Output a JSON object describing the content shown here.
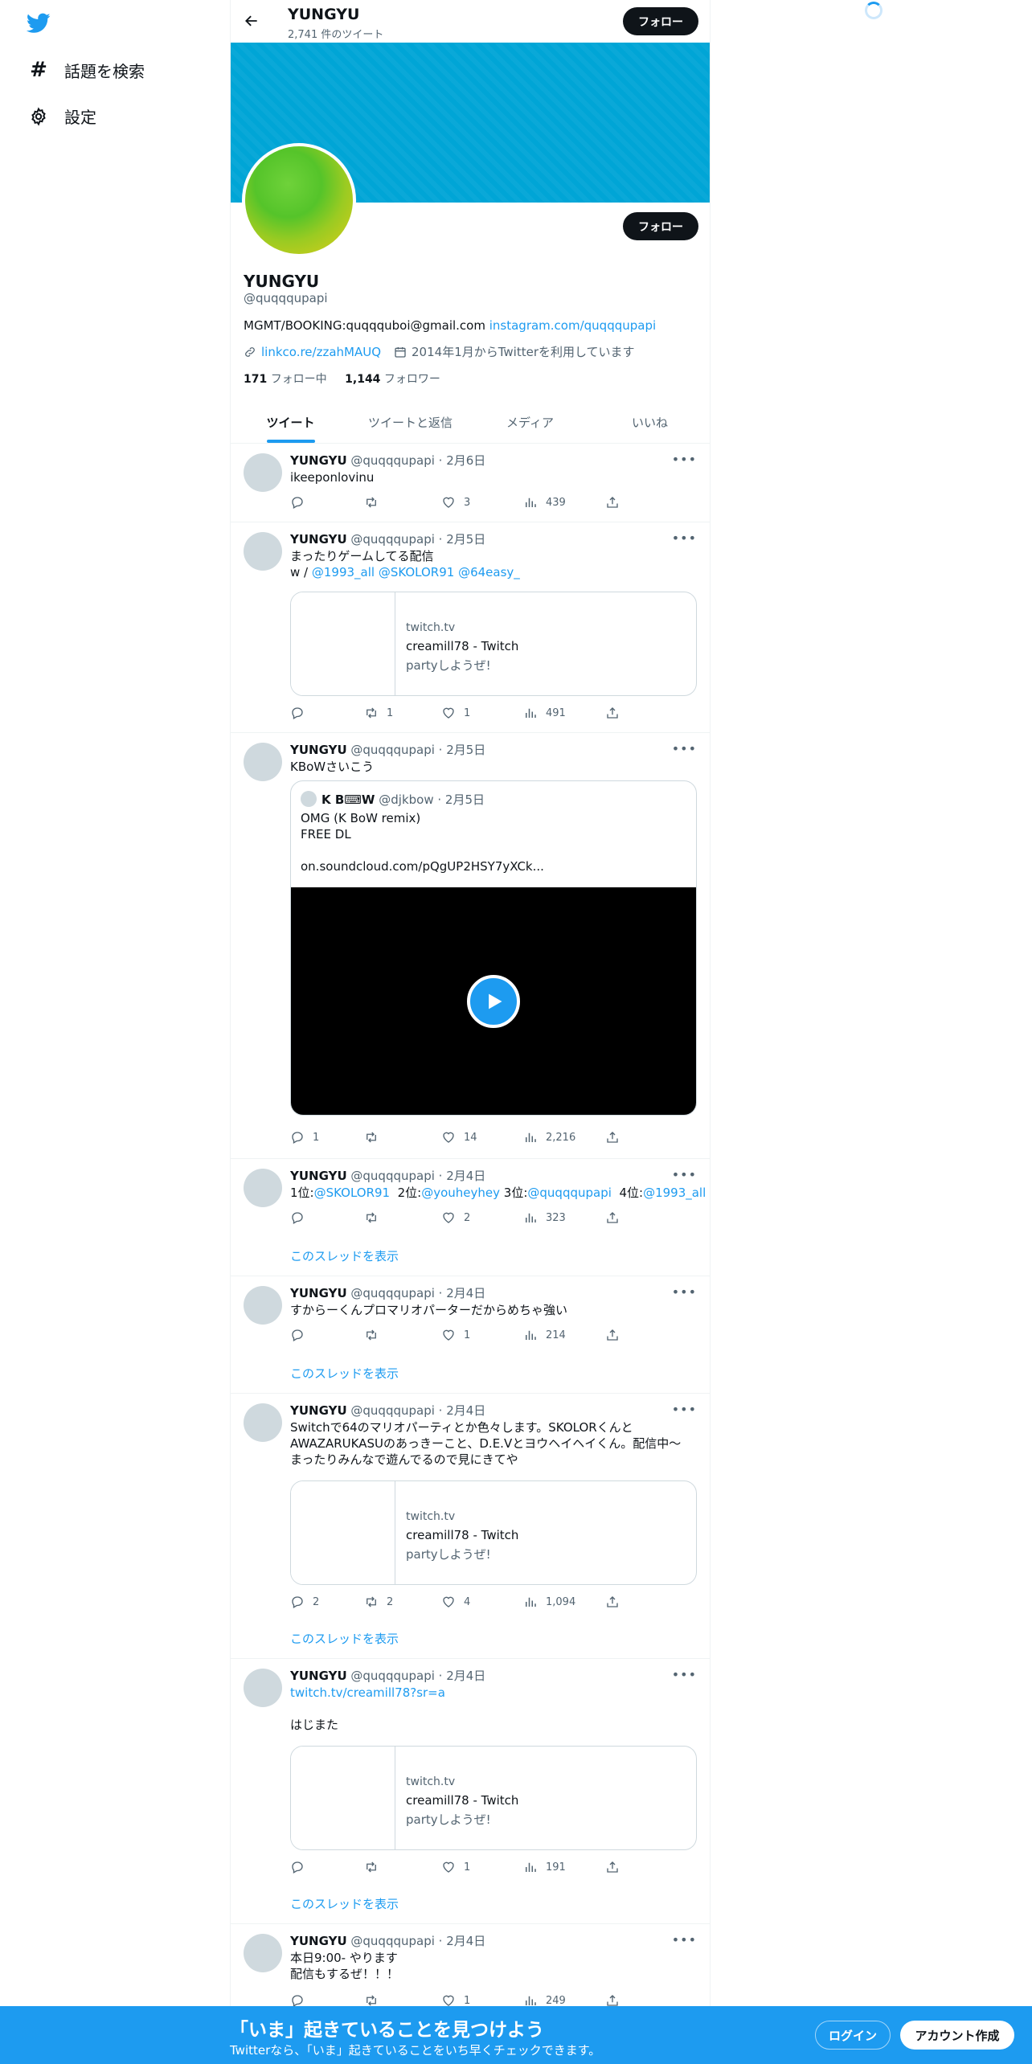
{
  "nav": {
    "explore": "話題を検索",
    "settings": "設定"
  },
  "header": {
    "name": "YUNGYU",
    "tweet_count": "2,741 件のツイート",
    "follow": "フォロー"
  },
  "profile": {
    "follow": "フォロー",
    "name": "YUNGYU",
    "handle": "@quqqqupapi",
    "bio_text": "MGMT/BOOKING:quqqquboi@gmail.com",
    "bio_link": "instagram.com/quqqqupapi",
    "website": "linkco.re/zzahMAUQ",
    "joined": "2014年1月からTwitterを利用しています",
    "following_count": "171",
    "following_label": "フォロー中",
    "followers_count": "1,144",
    "followers_label": "フォロワー"
  },
  "tabs": [
    "ツイート",
    "ツイートと返信",
    "メディア",
    "いいね"
  ],
  "tweets": [
    {
      "name": "YUNGYU",
      "meta": "@quqqqupapi · 2月6日",
      "text": "ikeeponlovinu",
      "reply": "",
      "retweet": "",
      "like": "3",
      "views": "439"
    },
    {
      "name": "YUNGYU",
      "meta": "@quqqqupapi · 2月5日",
      "text1": "まったりゲームしてる配信",
      "text2a": "w / ",
      "mentions": "@1993_all  @SKOLOR91 @64easy_",
      "card_site": "twitch.tv",
      "card_title": "creamill78 - Twitch",
      "card_desc": "partyしようぜ!",
      "reply": "",
      "retweet": "1",
      "like": "1",
      "views": "491"
    },
    {
      "name": "YUNGYU",
      "meta": "@quqqqupapi · 2月5日",
      "text": "KBoWさいこう",
      "quote_name": "K B⌨W",
      "quote_meta": "@djkbow · 2月5日",
      "quote_text": "OMG (K BoW remix)\nFREE DL\n\non.soundcloud.com/pQgUP2HSY7yXCk...",
      "reply": "1",
      "retweet": "",
      "like": "14",
      "views": "2,216"
    },
    {
      "name": "YUNGYU",
      "meta": "@quqqqupapi · 2月4日",
      "t1": "1位:",
      "m1": "@SKOLOR91",
      "t2": "  2位:",
      "m2": "@youheyhey",
      "t3": " 3位:",
      "m3": "@quqqqupapi",
      "t4": "  4位:",
      "m4": "@1993_all",
      "thread": "このスレッドを表示",
      "reply": "",
      "retweet": "",
      "like": "2",
      "views": "323"
    },
    {
      "name": "YUNGYU",
      "meta": "@quqqqupapi · 2月4日",
      "text": "すからーくんプロマリオパーターだからめちゃ強い",
      "thread": "このスレッドを表示",
      "reply": "",
      "retweet": "",
      "like": "1",
      "views": "214"
    },
    {
      "name": "YUNGYU",
      "meta": "@quqqqupapi · 2月4日",
      "text": "Switchで64のマリオパーティとか色々します。SKOLORくんと\nAWAZARUKASUのあっきーこと、D.E.Vとヨウヘイヘイくん。配信中〜\n    まったりみんなで遊んでるので見にきてや",
      "card_site": "twitch.tv",
      "card_title": "creamill78 - Twitch",
      "card_desc": "partyしようぜ!",
      "thread": "このスレッドを表示",
      "reply": "2",
      "retweet": "2",
      "like": "4",
      "views": "1,094"
    },
    {
      "name": "YUNGYU",
      "meta": "@quqqqupapi · 2月4日",
      "link": "twitch.tv/creamill78?sr=a",
      "text": "はじまた",
      "card_site": "twitch.tv",
      "card_title": "creamill78 - Twitch",
      "card_desc": "partyしようぜ!",
      "thread": "このスレッドを表示",
      "reply": "",
      "retweet": "",
      "like": "1",
      "views": "191"
    },
    {
      "name": "YUNGYU",
      "meta": "@quqqqupapi · 2月4日",
      "text": "本日9:00- やります\n配信もするぜ！！！",
      "reply": "",
      "retweet": "",
      "like": "1",
      "views": "249"
    }
  ],
  "bottom_bar": {
    "title": "「いま」起きていることを見つけよう",
    "subtitle": "Twitterなら、「いま」起きていることをいち早くチェックできます。",
    "login": "ログイン",
    "signup": "アカウント作成"
  },
  "colors": {
    "accent": "#1d9bf0",
    "banner": "#00a5d6",
    "text": "#0f1419",
    "muted": "#536471"
  }
}
